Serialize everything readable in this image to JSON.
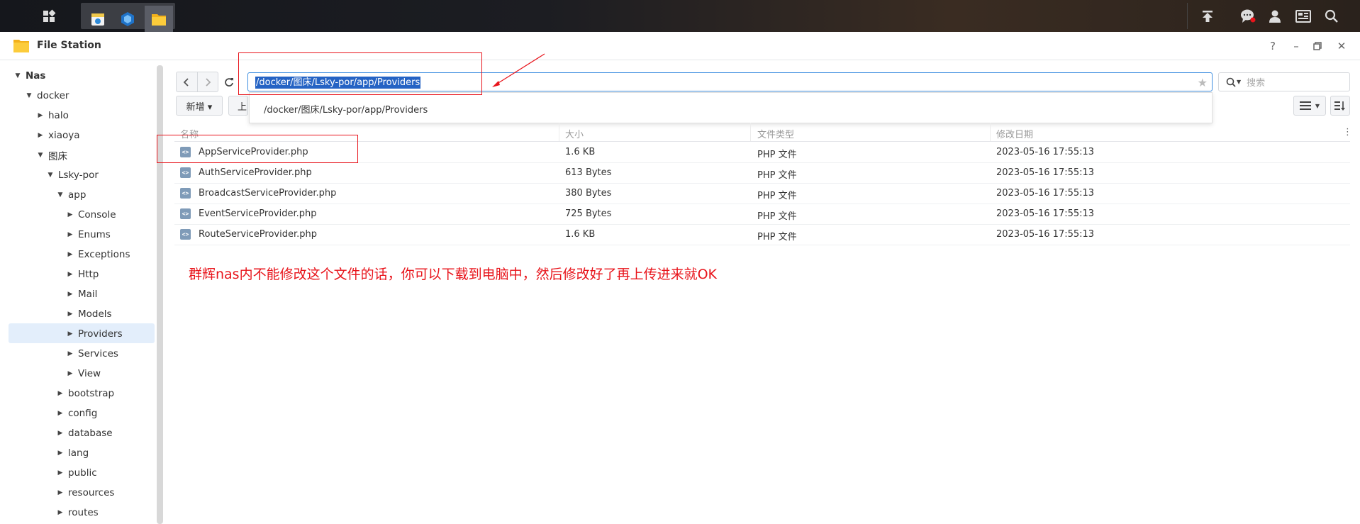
{
  "window": {
    "title": "File Station"
  },
  "navigation": {
    "path": "/docker/图床/Lsky-por/app/Providers",
    "path_suggestion": "/docker/图床/Lsky-por/app/Providers",
    "search_placeholder": "搜索"
  },
  "toolbar": {
    "new_label": "新增 ▾",
    "upload_label": "上"
  },
  "sidebar": {
    "items": [
      {
        "label": "Nas",
        "depth": 0,
        "arrow": "▼"
      },
      {
        "label": "docker",
        "depth": 1,
        "arrow": "▼"
      },
      {
        "label": "halo",
        "depth": 2,
        "arrow": "▶"
      },
      {
        "label": "xiaoya",
        "depth": 2,
        "arrow": "▶"
      },
      {
        "label": "图床",
        "depth": 2,
        "arrow": "▼"
      },
      {
        "label": "Lsky-por",
        "depth": 3,
        "arrow": "▼"
      },
      {
        "label": "app",
        "depth": 4,
        "arrow": "▼"
      },
      {
        "label": "Console",
        "depth": 5,
        "arrow": "▶"
      },
      {
        "label": "Enums",
        "depth": 5,
        "arrow": "▶"
      },
      {
        "label": "Exceptions",
        "depth": 5,
        "arrow": "▶"
      },
      {
        "label": "Http",
        "depth": 5,
        "arrow": "▶"
      },
      {
        "label": "Mail",
        "depth": 5,
        "arrow": "▶"
      },
      {
        "label": "Models",
        "depth": 5,
        "arrow": "▶"
      },
      {
        "label": "Providers",
        "depth": 5,
        "arrow": "▶",
        "selected": true
      },
      {
        "label": "Services",
        "depth": 5,
        "arrow": "▶"
      },
      {
        "label": "View",
        "depth": 5,
        "arrow": "▶"
      },
      {
        "label": "bootstrap",
        "depth": 4,
        "arrow": "▶"
      },
      {
        "label": "config",
        "depth": 4,
        "arrow": "▶"
      },
      {
        "label": "database",
        "depth": 4,
        "arrow": "▶"
      },
      {
        "label": "lang",
        "depth": 4,
        "arrow": "▶"
      },
      {
        "label": "public",
        "depth": 4,
        "arrow": "▶"
      },
      {
        "label": "resources",
        "depth": 4,
        "arrow": "▶"
      },
      {
        "label": "routes",
        "depth": 4,
        "arrow": "▶"
      }
    ]
  },
  "table": {
    "columns": [
      "名称",
      "大小",
      "文件类型",
      "修改日期"
    ],
    "rows": [
      {
        "name": "AppServiceProvider.php",
        "size": "1.6 KB",
        "type": "PHP 文件",
        "modified": "2023-05-16 17:55:13"
      },
      {
        "name": "AuthServiceProvider.php",
        "size": "613 Bytes",
        "type": "PHP 文件",
        "modified": "2023-05-16 17:55:13"
      },
      {
        "name": "BroadcastServiceProvider.php",
        "size": "380 Bytes",
        "type": "PHP 文件",
        "modified": "2023-05-16 17:55:13"
      },
      {
        "name": "EventServiceProvider.php",
        "size": "725 Bytes",
        "type": "PHP 文件",
        "modified": "2023-05-16 17:55:13"
      },
      {
        "name": "RouteServiceProvider.php",
        "size": "1.6 KB",
        "type": "PHP 文件",
        "modified": "2023-05-16 17:55:13"
      }
    ]
  },
  "annotation": {
    "note": "群辉nas内不能修改这个文件的话，你可以下载到电脑中，然后修改好了再上传进来就OK"
  },
  "colors": {
    "accent": "#2563c4",
    "annotation": "#e8141b",
    "selection": "#e3eefb"
  }
}
